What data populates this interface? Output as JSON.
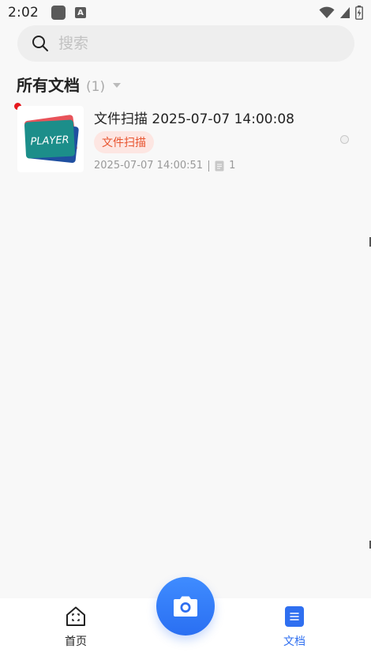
{
  "status_bar": {
    "time": "2:02",
    "a_badge": "A"
  },
  "search": {
    "placeholder": "搜索"
  },
  "section": {
    "title": "所有文档",
    "count": "(1)"
  },
  "documents": [
    {
      "title": "文件扫描 2025-07-07 14:00:08",
      "tag": "文件扫描",
      "modified": "2025-07-07 14:00:51",
      "pages": "1",
      "thumbnail_text": "PLAYER",
      "unread": true
    }
  ],
  "nav": {
    "home_label": "首页",
    "docs_label": "文档",
    "active": "docs"
  },
  "colors": {
    "accent": "#2f6ff0",
    "tag_bg": "#fde6e2",
    "tag_text": "#e8542f",
    "unread_dot": "#e6181e"
  },
  "icons": [
    "wifi-icon",
    "signal-icon",
    "battery-icon",
    "search-icon",
    "page-icon",
    "home-icon",
    "document-icon",
    "camera-icon"
  ]
}
